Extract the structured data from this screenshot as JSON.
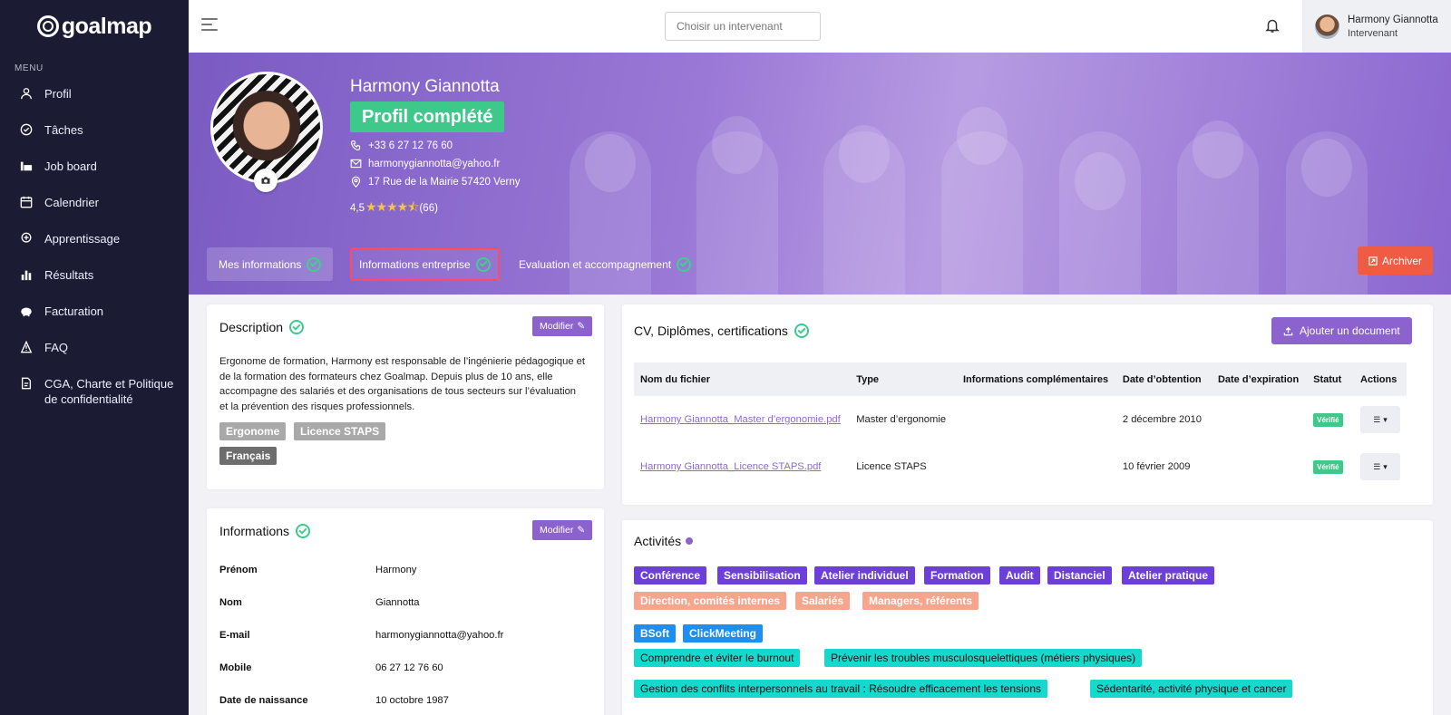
{
  "app": {
    "logo": "goalmap"
  },
  "sidebar": {
    "menu_title": "MENU",
    "items": [
      {
        "label": "Profil",
        "icon": "user-icon"
      },
      {
        "label": "Tâches",
        "icon": "check-circle-icon"
      },
      {
        "label": "Job board",
        "icon": "job-board-icon"
      },
      {
        "label": "Calendrier",
        "icon": "calendar-icon"
      },
      {
        "label": "Apprentissage",
        "icon": "learning-icon"
      },
      {
        "label": "Résultats",
        "icon": "bar-chart-icon"
      },
      {
        "label": "Facturation",
        "icon": "piggy-bank-icon"
      },
      {
        "label": "FAQ",
        "icon": "faq-icon"
      },
      {
        "label": "CGA, Charte et Politique de confidentialité",
        "icon": "document-icon"
      }
    ]
  },
  "header": {
    "search_placeholder": "Choisir un intervenant",
    "user_name": "Harmony Giannotta",
    "user_role": "Intervenant"
  },
  "profile": {
    "name": "Harmony Giannotta",
    "status": "Profil complété",
    "phone": "+33 6 27 12 76 60",
    "email": "harmonygiannotta@yahoo.fr",
    "address": "17 Rue de la Mairie 57420 Verny",
    "rating": "4,5",
    "stars": "★★★★⯪",
    "reviews": "(66)"
  },
  "tabs": [
    {
      "label": "Mes informations"
    },
    {
      "label": "Informations entreprise"
    },
    {
      "label": "Evaluation et accompagnement"
    }
  ],
  "archive_label": "Archiver",
  "description": {
    "title": "Description",
    "edit_label": "Modifier",
    "text": "Ergonome de formation, Harmony est responsable de l’ingénierie pédagogique et de la formation des formateurs chez Goalmap. Depuis plus de 10 ans, elle accompagne des salariés et des organisations de tous secteurs sur l’évaluation et la prévention des risques professionnels.",
    "skills": [
      "Ergonome",
      "Licence STAPS"
    ],
    "languages": [
      "Français"
    ]
  },
  "informations": {
    "title": "Informations",
    "edit_label": "Modifier",
    "rows": [
      {
        "label": "Prénom",
        "value": "Harmony"
      },
      {
        "label": "Nom",
        "value": "Giannotta"
      },
      {
        "label": "E-mail",
        "value": "harmonygiannotta@yahoo.fr"
      },
      {
        "label": "Mobile",
        "value": "06 27 12 76 60"
      },
      {
        "label": "Date de naissance",
        "value": "10 octobre 1987"
      }
    ]
  },
  "documents": {
    "title": "CV, Diplômes, certifications",
    "add_label": "Ajouter un document",
    "columns": [
      "Nom du fichier",
      "Type",
      "Informations complémentaires",
      "Date d’obtention",
      "Date d’expiration",
      "Statut",
      "Actions"
    ],
    "rows": [
      {
        "file": "Harmony Giannotta_Master d’ergonomie.pdf",
        "type": "Master d’ergonomie",
        "info": "",
        "obtained": "2 décembre 2010",
        "expires": "",
        "status": "Vérifié"
      },
      {
        "file": "Harmony Giannotta_Licence STAPS.pdf",
        "type": "Licence STAPS",
        "info": "",
        "obtained": "10 février 2009",
        "expires": "",
        "status": "Vérifié"
      }
    ]
  },
  "activities": {
    "title": "Activités",
    "formats": [
      "Conférence",
      "Sensibilisation",
      "Atelier individuel",
      "Formation",
      "Audit",
      "Distanciel",
      "Atelier pratique"
    ],
    "audiences": [
      "Direction, comités internes",
      "Salariés",
      "Managers, référents"
    ],
    "tools": [
      "BSoft",
      "ClickMeeting"
    ],
    "themes": [
      "Comprendre et éviter le burnout",
      "Prévenir les troubles musculosquelettiques (métiers physiques)",
      "Gestion des conflits interpersonnels au travail : Résoudre efficacement les tensions",
      "Sédentarité, activité physique et cancer"
    ]
  },
  "colors": {
    "sidebar": "#1b1c33",
    "accent": "#8c62cf",
    "success": "#3ec88a",
    "danger": "#ef5b43"
  }
}
